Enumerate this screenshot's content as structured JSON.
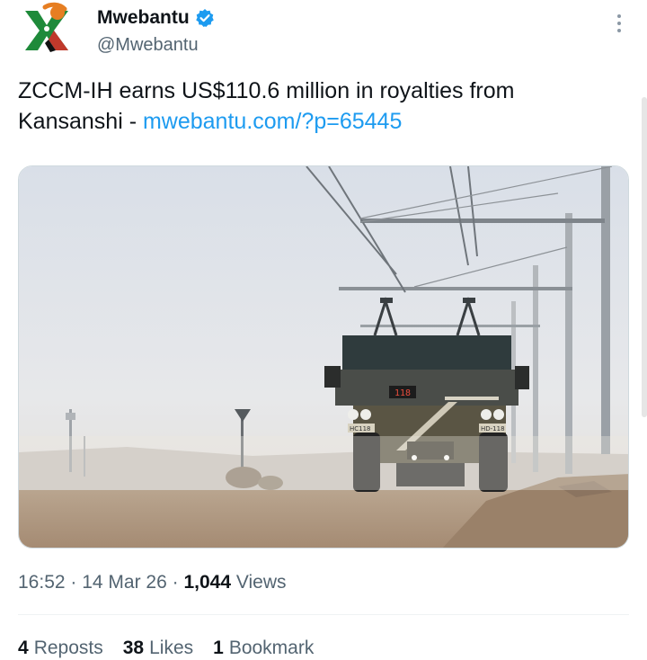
{
  "author": {
    "display_name": "Mwebantu",
    "handle": "@Mwebantu",
    "verified": true,
    "avatar_icon": "mwebantu-logo-icon"
  },
  "tweet": {
    "text": "ZCCM-IH earns US$110.6 million in royalties from Kansanshi - ",
    "link": "mwebantu.com/?p=65445"
  },
  "media": {
    "description_icon": "mining-truck-photo",
    "truck_plate_left": "HC118",
    "truck_plate_right": "HD-118",
    "truck_display": "118"
  },
  "meta": {
    "time": "16:52",
    "date": "14 Mar 26",
    "views_count": "1,044",
    "views_label": "Views"
  },
  "stats": {
    "reposts_count": "4",
    "reposts_label": "Reposts",
    "likes_count": "38",
    "likes_label": "Likes",
    "bookmarks_count": "1",
    "bookmarks_label": "Bookmark"
  },
  "colors": {
    "link": "#1d9bf0",
    "verified": "#1d9bf0",
    "secondary_text": "#536471"
  }
}
